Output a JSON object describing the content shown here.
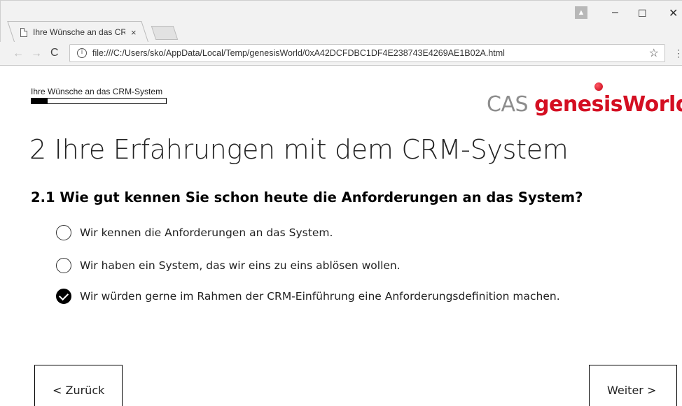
{
  "browser": {
    "tab_title": "Ihre Wünsche an das CRM-System",
    "tab_close": "×",
    "profile_icon": "person-icon",
    "window": {
      "minimize": "–",
      "maximize": "☐",
      "close": "✕"
    },
    "back": "←",
    "forward": "→",
    "reload": "C",
    "info": "i",
    "url": "file:///C:/Users/sko/AppData/Local/Temp/genesisWorld/0xA42DCFDBC1DF4E238743E4269AE1B02A.html",
    "bookmark": "☆",
    "menu": "⋮"
  },
  "page": {
    "progress_label": "Ihre Wünsche an das CRM-System",
    "progress_fraction": 0.12,
    "logo": {
      "cas": "CAS ",
      "genesis": "genesisWorld",
      "color_gray": "#8d8d8d",
      "color_red": "#d40f22"
    },
    "section_title": "2 Ihre Erfahrungen mit dem CRM-System",
    "question": "2.1  Wie gut kennen Sie schon heute die Anforderungen an das System?",
    "options": [
      {
        "label": "Wir kennen die Anforderungen an das System.",
        "selected": false
      },
      {
        "label": "Wir haben ein System, das wir eins zu eins ablösen wollen.",
        "selected": false
      },
      {
        "label": "Wir würden gerne im Rahmen der CRM-Einführung eine Anforderungsdefinition machen.",
        "selected": true
      }
    ],
    "back_button": "< Zurück",
    "next_button": "Weiter >"
  }
}
